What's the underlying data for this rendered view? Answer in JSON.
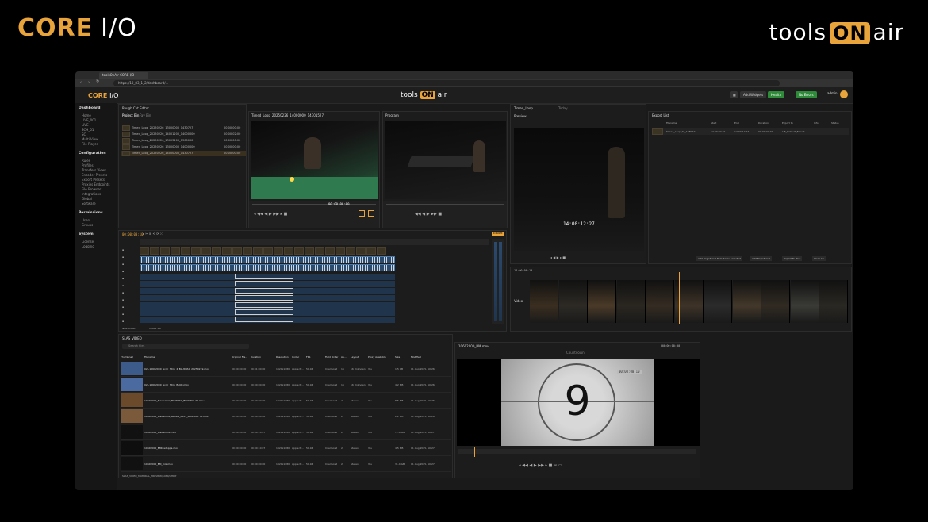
{
  "brand": {
    "left_core": "CORE",
    "left_io": "I/O",
    "right_pre": "tools",
    "right_on": "ON",
    "right_post": "air"
  },
  "browser": {
    "tab_title": "toolsOnAir CORE I/O",
    "url": "https://10_83_1_2/dashboard/..."
  },
  "app_header": {
    "logo_core": "CORE",
    "logo_io": "I/O",
    "brand_pre": "tools",
    "brand_on": "ON",
    "brand_post": "air",
    "add_widgets": "Add Widgets",
    "health": "Health",
    "no_errors": "No Errors",
    "user": "admin"
  },
  "sidebar": {
    "sections": [
      {
        "title": "Dashboard",
        "items": [
          "Home",
          "LIVE_001",
          "LIVE",
          "SCH_01",
          "SC",
          "Multi View",
          "File Player"
        ]
      },
      {
        "title": "Configuration",
        "items": [
          "Rules",
          "Profiles",
          "Transfers Views",
          "Encoder Presets",
          "Export Presets",
          "Proxies Endpoints",
          "File Browser",
          "Integrations",
          "Global",
          "Software"
        ]
      },
      {
        "title": "Permissions",
        "items": [
          "Users",
          "Groups"
        ]
      },
      {
        "title": "System",
        "items": [
          "License",
          "Logging"
        ]
      }
    ]
  },
  "rough_cut": {
    "title": "Rough Cut Editor",
    "tab_project": "Project Bin",
    "tab_clips": "Fav Bin",
    "bin_items": [
      {
        "name": "Timed_Loop_20250226_13000000_1430727",
        "tc": "00:00:00:00"
      },
      {
        "name": "Timed_Loop_20250226_14001200_14000000",
        "tc": "00:00:02:00"
      },
      {
        "name": "Timed_Loop_20250226_13003200_1300000",
        "tc": "00:00:00:00"
      },
      {
        "name": "Timed_Loop_20250226_13000000_14000000",
        "tc": "00:00:00:00"
      },
      {
        "name": "Timed_Loop_20250226_14000000_1430727",
        "tc": "00:00:00:00"
      }
    ]
  },
  "viewer_left": {
    "title": "Timed_Loop_20250226_14000000_14301527",
    "tc": "00:00:00:00"
  },
  "viewer_right": {
    "title": "Program",
    "tc": "00:00:00:00"
  },
  "timeline": {
    "tc": "00:00:00:10",
    "project": "New Project",
    "format": "1080P 50i",
    "export_btn": "Export"
  },
  "preview": {
    "header": "Timed_Loop",
    "preview_label": "Preview",
    "tc_overlay": "14:00:12:27",
    "today": "Today"
  },
  "export_list": {
    "title": "Export List",
    "cols": [
      "Filename",
      "Start",
      "End",
      "Duration",
      "Export to",
      "Info",
      "Status"
    ],
    "row": {
      "name": "Timed_Loop_20_1080227",
      "start": "14:00:00:19",
      "end": "14:00:12:27",
      "dur": "00:00:00:19",
      "to": "LIB_Default_Export"
    },
    "buttons": [
      "Add Registered Item Items Selected",
      "Add Registered",
      "Export To Files",
      "Clear All"
    ]
  },
  "filmstrip": {
    "label": "Video",
    "start_tc": "14:00:00:19"
  },
  "file_browser": {
    "path": "SLAS_VIDEO",
    "search_ph": "Search files",
    "cols": [
      "Thumbnail",
      "Filename",
      "Original Fra...",
      "Duration",
      "Resolution",
      "Codec",
      "FPS",
      "Field Order",
      "Au...",
      "Layout",
      "Proxy Available",
      "Size",
      "Modified"
    ],
    "rows": [
      {
        "name": "02~10602000_Sync_Strip_4_BLUD4S0_20250219.mov",
        "fr": "00:00:00:00",
        "dur": "00:01:00:00",
        "res": "1920x1080",
        "codec": "Apple Pr...",
        "fps": "59.94",
        "fo": "Interlaced",
        "au": "16",
        "layout": "16 Unknown",
        "proxy": "Yes",
        "size": "1.5 GB",
        "mod": "01 Aug 2025, 10:26"
      },
      {
        "name": "02~10602000_Sync_Strip_BLUD.mov",
        "fr": "00:00:00:00",
        "dur": "00:00:00:00",
        "res": "1920x1080",
        "codec": "Apple Pr...",
        "fps": "59.94",
        "fo": "Interlaced",
        "au": "16",
        "layout": "16 Unknown",
        "proxy": "Yes",
        "size": "4.2 MB",
        "mod": "01 Aug 2025, 10:26"
      },
      {
        "name": "10602000_Mastermix_BLUD4S0_BLUD4S0 73.mov",
        "fr": "00:00:00:00",
        "dur": "00:00:00:00",
        "res": "1920x1080",
        "codec": "Apple Pr...",
        "fps": "59.94",
        "fo": "Interlaced",
        "au": "2",
        "layout": "Stereo",
        "proxy": "Yes",
        "size": "8.5 MB",
        "mod": "01 Aug 2025, 10:26"
      },
      {
        "name": "10602000_Mastermix_BLUD4_0323_BLUD4S0 73.mov",
        "fr": "00:00:00:00",
        "dur": "00:00:00:00",
        "res": "1920x1080",
        "codec": "Apple Pr...",
        "fps": "59.94",
        "fo": "Interlaced",
        "au": "2",
        "layout": "Stereo",
        "proxy": "Yes",
        "size": "2.2 MB",
        "mod": "01 Aug 2025, 10:26"
      },
      {
        "name": "10602000_Mastermix.mov",
        "fr": "00:00:00:00",
        "dur": "00:00:10:07",
        "res": "1920x1080",
        "codec": "Apple Pr...",
        "fps": "59.94",
        "fo": "Interlaced",
        "au": "2",
        "layout": "Stereo",
        "proxy": "Yes",
        "size": "71.8 MB",
        "mod": "01 Aug 2025, 10:27"
      },
      {
        "name": "10602000_BMlivetoppa.mov",
        "fr": "00:00:00:00",
        "dur": "00:00:10:07",
        "res": "1920x1080",
        "codec": "Apple Pr...",
        "fps": "59.94",
        "fo": "Interlaced",
        "au": "2",
        "layout": "Stereo",
        "proxy": "Yes",
        "size": "4.5 MB",
        "mod": "01 Aug 2025, 10:27"
      },
      {
        "name": "10602000_BM_mix.mov",
        "fr": "00:00:00:00",
        "dur": "00:00:00:00",
        "res": "1920x1080",
        "codec": "Apple Pr...",
        "fps": "59.94",
        "fo": "Interlaced",
        "au": "2",
        "layout": "Stereo",
        "proxy": "Yes",
        "size": "31.4 GB",
        "mod": "01 Aug 2025, 10:27"
      }
    ],
    "footer": "SLAS_VIDEO_MATERIAL_PREVIEW/1080/UHDP"
  },
  "countdown": {
    "title": "10602000_BM.mov",
    "tc": "00:00:00:00",
    "tc_overlay": "00:00:00:10",
    "number": "9",
    "subtitle": "Countdown"
  }
}
